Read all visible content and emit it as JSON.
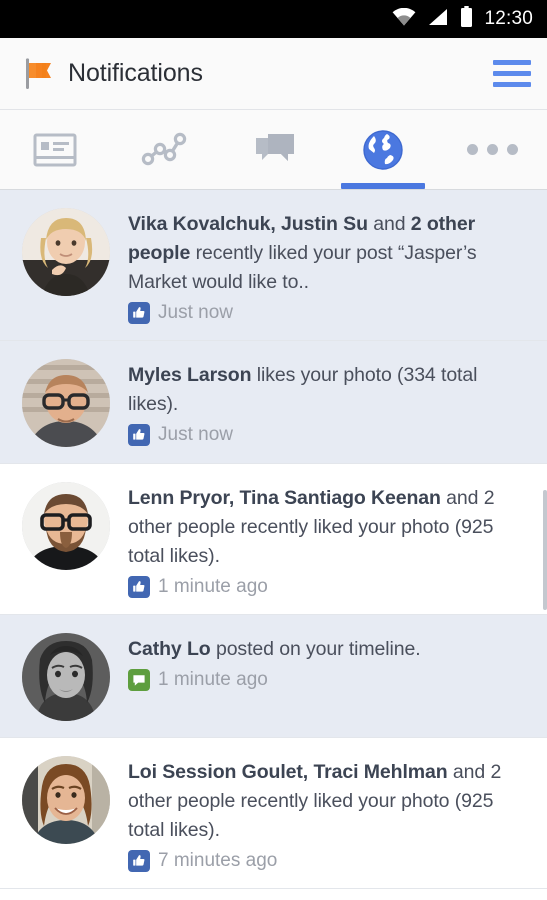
{
  "status_bar": {
    "time": "12:30",
    "icons": [
      "wifi-icon",
      "cellular-signal-icon",
      "battery-icon"
    ]
  },
  "header": {
    "title": "Notifications",
    "logo_icon": "flag-icon",
    "menu_icon": "hamburger-menu-icon"
  },
  "tabs": [
    {
      "name": "news-feed",
      "icon": "news-feed-icon",
      "active": false
    },
    {
      "name": "friend-requests",
      "icon": "friend-requests-icon",
      "active": false
    },
    {
      "name": "messages",
      "icon": "messages-icon",
      "active": false
    },
    {
      "name": "notifications",
      "icon": "globe-icon",
      "active": true
    },
    {
      "name": "more",
      "icon": "more-dots-icon",
      "active": false
    }
  ],
  "colors": {
    "accent": "#4b78e0",
    "like_badge": "#4267b2",
    "comment_badge": "#5e9e3e",
    "unread_row": "#e7ebf3",
    "read_row": "#ffffff",
    "flag": "#f5821f"
  },
  "notifications": [
    {
      "unread": true,
      "avatar": "blonde-woman-avatar",
      "segments": [
        {
          "text": "Vika Kovalchuk, Justin Su",
          "bold": true
        },
        {
          "text": " and ",
          "bold": false
        },
        {
          "text": "2 other people",
          "bold": true
        },
        {
          "text": " recently liked your post “Jasper’s Market would like to..",
          "bold": false
        }
      ],
      "badge": "like-icon",
      "time": "Just now"
    },
    {
      "unread": true,
      "avatar": "man-with-glasses-avatar",
      "segments": [
        {
          "text": "Myles Larson",
          "bold": true
        },
        {
          "text": " likes your photo (334 total likes).",
          "bold": false
        }
      ],
      "badge": "like-icon",
      "time": "Just now"
    },
    {
      "unread": false,
      "avatar": "bearded-man-avatar",
      "segments": [
        {
          "text": "Lenn Pryor, Tina Santiago Keenan",
          "bold": true
        },
        {
          "text": " and 2 other people recently liked your photo (925 total likes).",
          "bold": false
        }
      ],
      "badge": "like-icon",
      "time": "1 minute ago"
    },
    {
      "unread": true,
      "avatar": "bw-woman-avatar",
      "segments": [
        {
          "text": "Cathy Lo",
          "bold": true
        },
        {
          "text": " posted on your timeline.",
          "bold": false
        }
      ],
      "badge": "comment-icon",
      "time": "1 minute ago"
    },
    {
      "unread": false,
      "avatar": "smiling-woman-avatar",
      "segments": [
        {
          "text": "Loi Session Goulet, Traci Mehlman",
          "bold": true
        },
        {
          "text": " and 2 other people recently liked your photo (925 total likes).",
          "bold": false
        }
      ],
      "badge": "like-icon",
      "time": "7 minutes ago"
    }
  ]
}
